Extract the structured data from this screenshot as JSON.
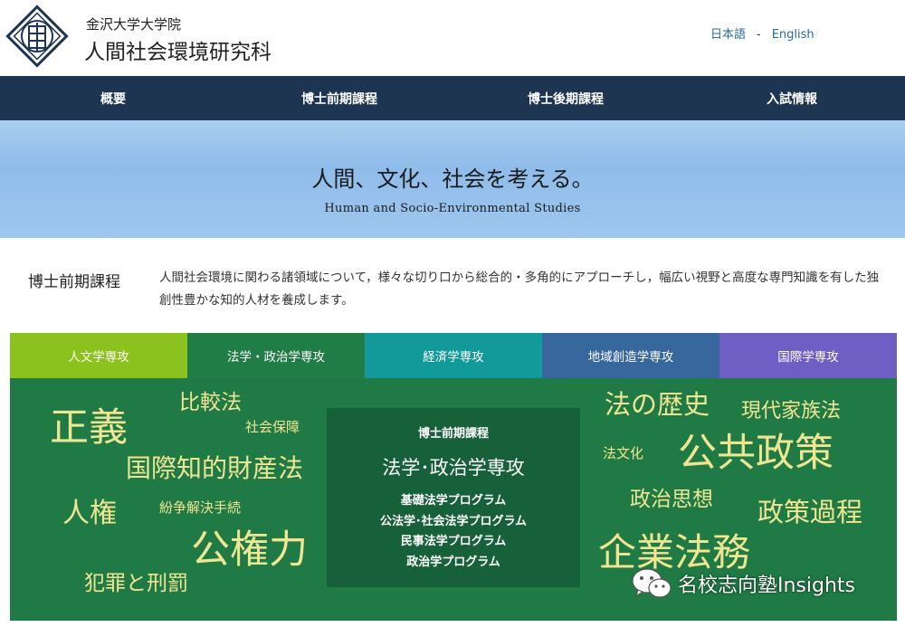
{
  "header": {
    "university": "金沢大学大学院",
    "graduate_school": "人間社会環境研究科",
    "lang_ja": "日本語",
    "lang_sep": "-",
    "lang_en": "English"
  },
  "nav": {
    "items": [
      {
        "label": "概要"
      },
      {
        "label": "博士前期課程"
      },
      {
        "label": "博士後期課程"
      },
      {
        "label": "入試情報"
      }
    ]
  },
  "hero": {
    "title": "人間、文化、社会を考える。",
    "subtitle": "Human and Socio-Environmental Studies"
  },
  "intro": {
    "label": "博士前期課程",
    "text": "人間社会環境に関わる諸領域について，様々な切り口から総合的・多角的にアプローチし，幅広い視野と高度な専門知識を有した独創性豊かな知的人材を養成します。"
  },
  "tabs": [
    {
      "label": "人文学専攻",
      "color": "#8cc21e"
    },
    {
      "label": "法学・政治学専攻",
      "color": "#1f7d45"
    },
    {
      "label": "経済学専攻",
      "color": "#12999a"
    },
    {
      "label": "地域創造学専攻",
      "color": "#37679c"
    },
    {
      "label": "国際学専攻",
      "color": "#6f5ec3"
    }
  ],
  "panel": {
    "keywords": {
      "k1": "正義",
      "k2": "比較法",
      "k3": "社会保障",
      "k4": "国際知的財産法",
      "k5": "人権",
      "k6": "紛争解決手続",
      "k7": "公権力",
      "k8": "犯罪と刑罰",
      "k9": "法の歴史",
      "k10": "現代家族法",
      "k11": "法文化",
      "k12": "公共政策",
      "k13": "政治思想",
      "k14": "政策過程",
      "k15": "企業法務"
    },
    "center": {
      "top": "博士前期課程",
      "title": "法学･政治学専攻",
      "programs": [
        "基礎法学プログラム",
        "公法学･社会法学プログラム",
        "民事法学プログラム",
        "政治学プログラム"
      ]
    }
  },
  "watermark": {
    "text": "名校志向塾Insights"
  }
}
